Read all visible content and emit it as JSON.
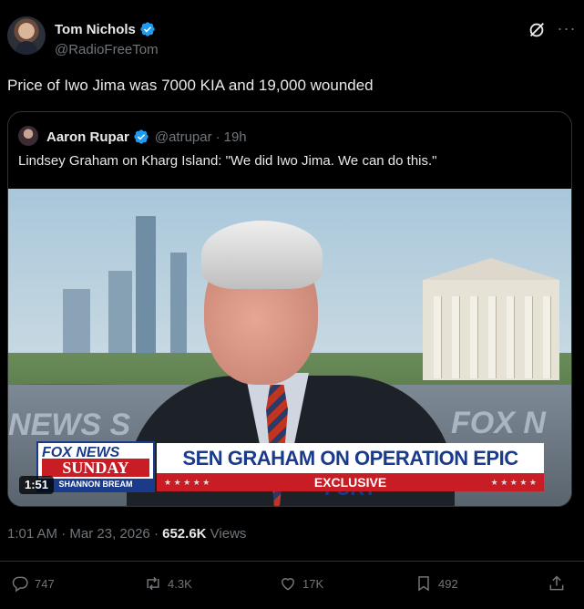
{
  "author": {
    "name": "Tom Nichols",
    "handle": "@RadioFreeTom"
  },
  "post_text": "Price of Iwo Jima was 7000 KIA and 19,000 wounded",
  "quoted": {
    "name": "Aaron Rupar",
    "handle": "@atrupar",
    "separator": "·",
    "time": "19h",
    "text": "Lindsey Graham on Kharg Island: \"We did Iwo Jima. We can do this.\"",
    "video": {
      "duration": "1:51",
      "network_logo": "FOX NEWS",
      "show": "SUNDAY",
      "host": "SHANNON BREAM",
      "headline": "SEN GRAHAM ON OPERATION EPIC FURY",
      "tag": "EXCLUSIVE",
      "wall_left": "NEWS S",
      "wall_right": "FOX N"
    }
  },
  "meta": {
    "time": "1:01 AM",
    "separator": "·",
    "date": "Mar 23, 2026",
    "separator2": "·",
    "views": "652.6K",
    "views_label": "Views"
  },
  "actions": {
    "replies": "747",
    "reposts": "4.3K",
    "likes": "17K",
    "bookmarks": "492"
  },
  "colors": {
    "background": "#000000",
    "verified": "#1d9bf0",
    "muted": "#71767b",
    "fox_blue": "#1a3b8c",
    "fox_red": "#c81d25"
  },
  "icons": [
    "verified-badge-icon",
    "grok-icon",
    "more-icon",
    "reply-icon",
    "repost-icon",
    "like-icon",
    "bookmark-icon",
    "share-icon"
  ]
}
